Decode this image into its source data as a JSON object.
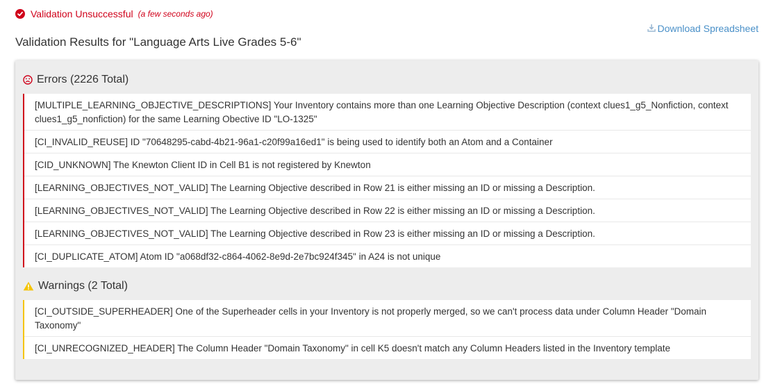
{
  "status": {
    "label": "Validation Unsuccessful",
    "time": "(a few seconds ago)"
  },
  "download": {
    "label": "Download Spreadsheet",
    "icon": "download-icon"
  },
  "page_title": "Validation Results for \"Language Arts Live Grades 5-6\"",
  "colors": {
    "error": "#d0021b",
    "warning": "#f5c400",
    "link": "#4a90c8"
  },
  "errors": {
    "heading": "Errors (2226 Total)",
    "icon": "sad-face-icon",
    "items": [
      "[MULTIPLE_LEARNING_OBJECTIVE_DESCRIPTIONS] Your Inventory contains more than one Learning Objective Description (context clues1_g5_Nonfiction, context clues1_g5_nonfiction) for the same Learning Obective ID \"LO-1325\"",
      "[CI_INVALID_REUSE] ID \"70648295-cabd-4b21-96a1-c20f99a16ed1\" is being used to identify both an Atom and a Container",
      "[CID_UNKNOWN] The Knewton Client ID in Cell B1 is not registered by Knewton",
      "[LEARNING_OBJECTIVES_NOT_VALID] The Learning Objective described in Row 21 is either missing an ID or missing a Description.",
      "[LEARNING_OBJECTIVES_NOT_VALID] The Learning Objective described in Row 22 is either missing an ID or missing a Description.",
      "[LEARNING_OBJECTIVES_NOT_VALID] The Learning Objective described in Row 23 is either missing an ID or missing a Description.",
      "[CI_DUPLICATE_ATOM] Atom ID \"a068df32-c864-4062-8e9d-2e7bc924f345\" in A24 is not unique"
    ]
  },
  "warnings": {
    "heading": "Warnings (2 Total)",
    "icon": "warning-triangle-icon",
    "items": [
      "[CI_OUTSIDE_SUPERHEADER] One of the Superheader cells in your Inventory is not properly merged, so we can't process data under Column Header \"Domain Taxonomy\"",
      "[CI_UNRECOGNIZED_HEADER] The Column Header \"Domain Taxonomy\" in cell K5 doesn't match any Column Headers listed in the Inventory template"
    ]
  }
}
